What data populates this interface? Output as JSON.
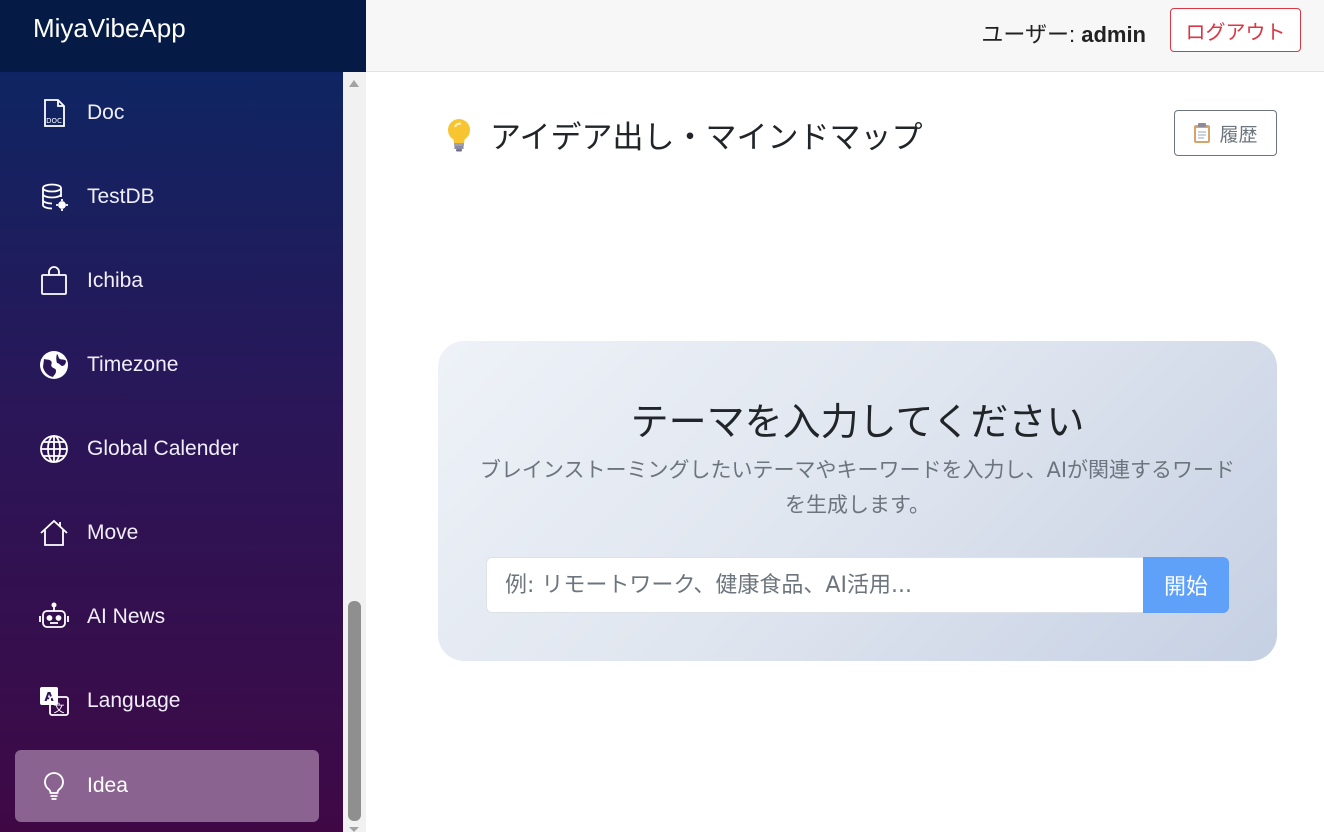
{
  "brand": {
    "name": "MiyaVibeApp"
  },
  "header": {
    "user_prefix": "ユーザー: ",
    "user_name": "admin",
    "logout_label": "ログアウト"
  },
  "sidebar": {
    "items": [
      {
        "label": "Doc",
        "icon": "doc-file-icon"
      },
      {
        "label": "TestDB",
        "icon": "database-gear-icon"
      },
      {
        "label": "Ichiba",
        "icon": "shopping-bag-icon"
      },
      {
        "label": "Timezone",
        "icon": "globe-icon"
      },
      {
        "label": "Global Calender",
        "icon": "globe-grid-icon"
      },
      {
        "label": "Move",
        "icon": "house-icon"
      },
      {
        "label": "AI News",
        "icon": "robot-icon"
      },
      {
        "label": "Language",
        "icon": "translate-icon"
      },
      {
        "label": "Idea",
        "icon": "lightbulb-icon",
        "active": true
      }
    ]
  },
  "main": {
    "title": "アイデア出し・マインドマップ",
    "history_label": "履歴",
    "card": {
      "title": "テーマを入力してください",
      "description": "ブレインストーミングしたいテーマやキーワードを入力し、AIが関連するワードを生成します。",
      "input_placeholder": "例: リモートワーク、健康食品、AI活用...",
      "input_value": "",
      "start_label": "開始"
    }
  },
  "colors": {
    "brand_bg": "#051a45",
    "sidebar_top": "#0f2563",
    "sidebar_bottom": "#3f0845",
    "active_item": "#8a6390",
    "logout": "#dc3545",
    "start_button": "#5fa0f8"
  }
}
